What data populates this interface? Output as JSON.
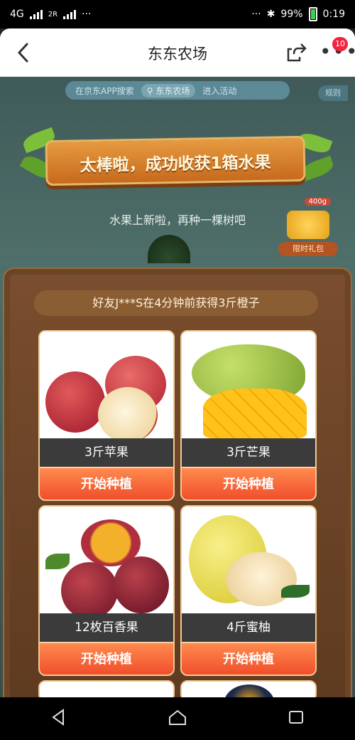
{
  "status_bar": {
    "network": "4G",
    "network2": "2R",
    "dots_left": "···",
    "dots_right": "···",
    "battery": "99%",
    "time": "0:19"
  },
  "nav": {
    "title": "东东农场",
    "badge": "10"
  },
  "scene": {
    "search_hint": "在京东APP搜索",
    "search_chip": "东东农场",
    "enter_label": "进入活动",
    "rule_tab": "规则",
    "banner": "太棒啦，成功收获1箱水果",
    "subtitle": "水果上新啦，再种一棵树吧",
    "side_tag": "400g",
    "side_button": "限时礼包"
  },
  "panel": {
    "friend_notice": "好友J***S在4分钟前获得3斤橙子",
    "cards": [
      {
        "name": "3斤苹果",
        "button": "开始种植"
      },
      {
        "name": "3斤芒果",
        "button": "开始种植"
      },
      {
        "name": "12枚百香果",
        "button": "开始种植"
      },
      {
        "name": "4斤蜜柚",
        "button": "开始种植"
      }
    ]
  }
}
